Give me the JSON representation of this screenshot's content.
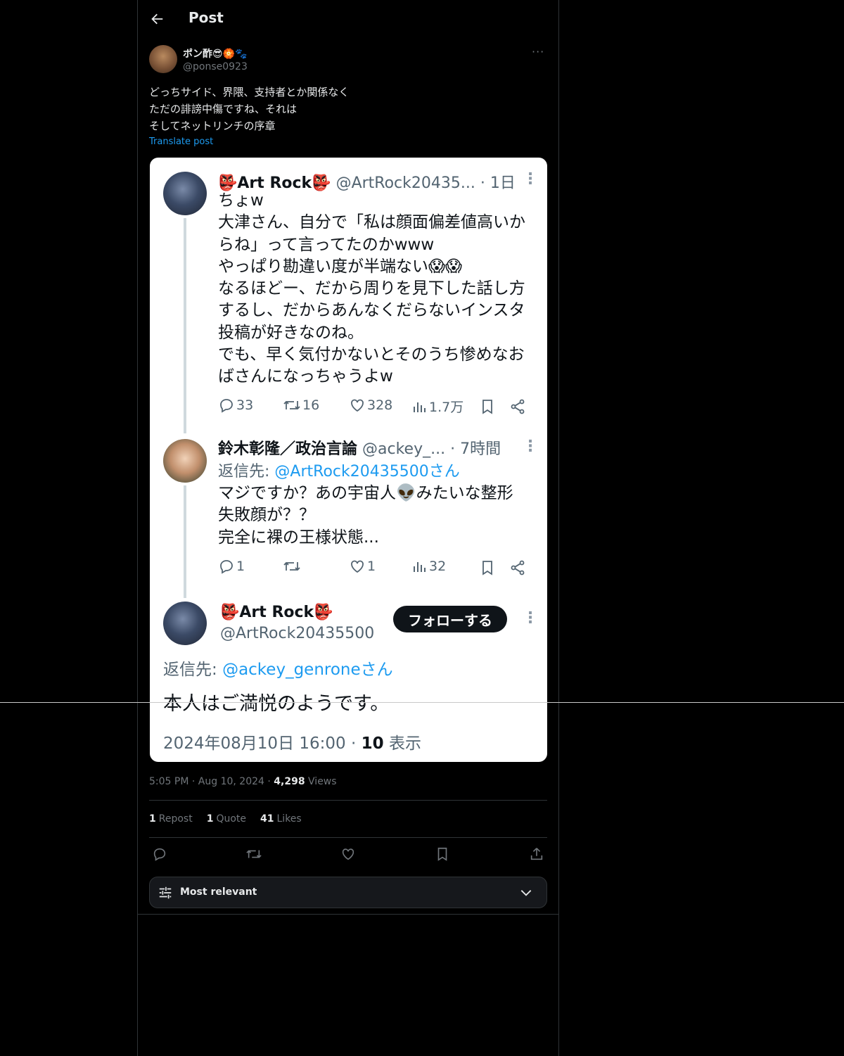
{
  "header": {
    "title": "Post"
  },
  "post": {
    "author_name": "ポン酢😎🏵️🐾",
    "author_handle": "@ponse0923",
    "more": "···",
    "text": "どっちサイド、界隈、支持者とか関係なく\nただの誹謗中傷ですね、それは\nそしてネットリンチの序章",
    "translate": "Translate post",
    "time": "5:05 PM",
    "date": "Aug 10, 2024",
    "views_count": "4,298",
    "views_label": "Views",
    "reposts_count": "1",
    "reposts_label": "Repost",
    "quotes_count": "1",
    "quotes_label": "Quote",
    "likes_count": "41",
    "likes_label": "Likes"
  },
  "card": {
    "t1": {
      "name": "👺Art Rock👺",
      "handle": "@ArtRock20435...",
      "age": "· 1日",
      "body": "ちょw\n大津さん、自分で「私は顔面偏差値高いか\nらね」って言ってたのかwww\nやっぱり勘違い度が半端ない😱😱\nなるほどー、だから周りを見下した話し方\nするし、だからあんなくだらないインスタ\n投稿が好きなのね。\nでも、早く気付かないとそのうち惨めなお\nばさんになっちゃうよw",
      "replies": "33",
      "reposts": "16",
      "likes": "328",
      "views": "1.7万"
    },
    "t2": {
      "name": "鈴木彰隆／政治言論",
      "handle": "@ackey_...",
      "age": "· 7時間",
      "reply_prefix": "返信先:",
      "reply_to": "@ArtRock20435500さん",
      "body": "マジですか？あの宇宙人👽みたいな整形\n失敗顔が？？\n完全に裸の王様状態...",
      "replies": "1",
      "reposts": "",
      "likes": "1",
      "views": "32"
    },
    "t3": {
      "name": "👺Art Rock👺",
      "handle": "@ArtRock20435500",
      "follow": "フォローする",
      "reply_prefix": "返信先:",
      "reply_to": "@ackey_genroneさん",
      "body": "本人はご満悦のようです。",
      "datetime": "2024年08月10日 16:00 ·",
      "views_count": "10",
      "views_label": "表示"
    }
  },
  "sort": {
    "label": "Most relevant"
  },
  "icons": {
    "back": "arrow-left-icon",
    "reply": "speech-bubble-icon",
    "repost": "repost-arrows-icon",
    "like": "heart-icon",
    "views": "bar-chart-icon",
    "bookmark": "bookmark-icon",
    "share": "share-icon",
    "upload": "upload-icon",
    "kebab": "vertical-dots-icon",
    "sliders": "sliders-icon",
    "chevron": "chevron-down-icon"
  },
  "colors": {
    "background": "#000000",
    "border": "#2f3336",
    "text": "#e7e9ea",
    "muted": "#71767b",
    "link": "#1d9bf0",
    "card_bg": "#ffffff"
  }
}
